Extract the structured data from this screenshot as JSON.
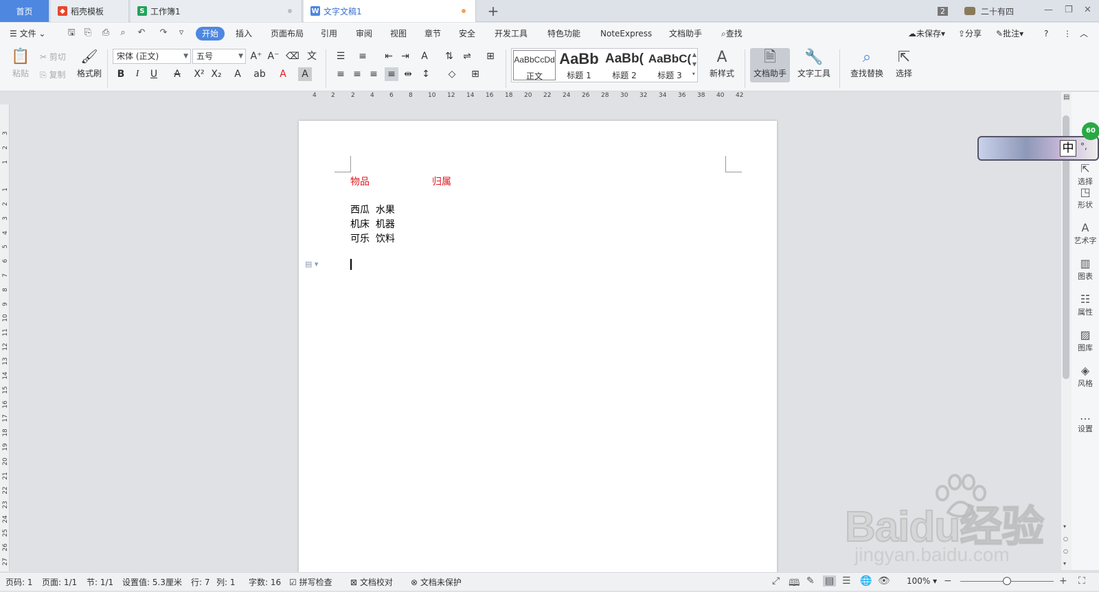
{
  "tabs": [
    {
      "label": "首页"
    },
    {
      "label": "稻壳模板"
    },
    {
      "label": "工作簿1"
    },
    {
      "label": "文字文稿1"
    }
  ],
  "topright": {
    "count": "2",
    "user": "二十有四"
  },
  "menu": {
    "file": "文件",
    "items": [
      "开始",
      "插入",
      "页面布局",
      "引用",
      "审阅",
      "视图",
      "章节",
      "安全",
      "开发工具",
      "特色功能",
      "NoteExpress",
      "文档助手"
    ],
    "search": "查找",
    "unsaved": "未保存",
    "share": "分享",
    "comment": "批注"
  },
  "ribbon": {
    "paste": "粘贴",
    "cut": "剪切",
    "copy": "复制",
    "format_painter": "格式刷",
    "font_name": "宋体 (正文)",
    "font_size": "五号",
    "styles": [
      {
        "preview": "AaBbCcDd",
        "name": "正文"
      },
      {
        "preview": "AaBb",
        "name": "标题 1"
      },
      {
        "preview": "AaBb(",
        "name": "标题 2"
      },
      {
        "preview": "AaBbC(",
        "name": "标题 3"
      }
    ],
    "new_style": "新样式",
    "doc_assistant": "文档助手",
    "text_tools": "文字工具",
    "find_replace": "查找替换",
    "select": "选择"
  },
  "ruler": {
    "h_ticks": [
      "4",
      "2",
      "2",
      "4",
      "6",
      "8",
      "10",
      "12",
      "14",
      "16",
      "18",
      "20",
      "22",
      "24",
      "26",
      "28",
      "30",
      "32",
      "34",
      "36",
      "38",
      "40",
      "42"
    ],
    "v_ticks": [
      "3",
      "2",
      "1",
      "1",
      "2",
      "3",
      "4",
      "5",
      "6",
      "7",
      "8",
      "9",
      "10",
      "11",
      "12",
      "13",
      "14",
      "15",
      "16",
      "17",
      "18",
      "19",
      "20",
      "21",
      "22",
      "23",
      "24",
      "25",
      "26",
      "27"
    ]
  },
  "document": {
    "header_cols": [
      "物品",
      "归属"
    ],
    "rows": [
      "西瓜  水果",
      "机床  机器",
      "可乐  饮料"
    ]
  },
  "side_panel": {
    "items": [
      "选择",
      "形状",
      "艺术字",
      "图表",
      "属性",
      "图库",
      "风格",
      "设置"
    ]
  },
  "floating": {
    "ime": "中",
    "badge": "60"
  },
  "status": {
    "page_no": "页码: 1",
    "pages": "页面: 1/1",
    "section": "节: 1/1",
    "setting": "设置值: 5.3厘米",
    "line": "行: 7",
    "col": "列: 1",
    "words": "字数: 16",
    "spell": "拼写检查",
    "proof": "文档校对",
    "protect": "文档未保护",
    "zoom": "100%"
  },
  "watermark": {
    "brand": "Baidu经验",
    "url": "jingyan.baidu.com"
  },
  "colors": {
    "accent": "#4d87e0",
    "red_text": "#e0181e"
  }
}
